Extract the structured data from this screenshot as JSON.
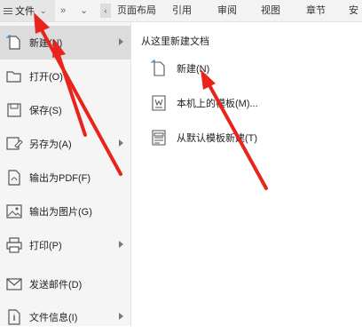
{
  "topbar": {
    "file_label": "文件",
    "tabs": [
      "页面布局",
      "引用",
      "审阅",
      "视图",
      "章节",
      "安全"
    ]
  },
  "sidebar": {
    "items": [
      {
        "label": "新建(N)",
        "icon": "new-doc-icon",
        "has_submenu": true,
        "active": true
      },
      {
        "label": "打开(O)",
        "icon": "folder-open-icon",
        "has_submenu": false
      },
      {
        "label": "保存(S)",
        "icon": "save-icon",
        "has_submenu": false
      },
      {
        "label": "另存为(A)",
        "icon": "save-as-icon",
        "has_submenu": true
      },
      {
        "label": "输出为PDF(F)",
        "icon": "pdf-export-icon",
        "has_submenu": false
      },
      {
        "label": "输出为图片(G)",
        "icon": "image-export-icon",
        "has_submenu": false
      },
      {
        "label": "打印(P)",
        "icon": "printer-icon",
        "has_submenu": true
      },
      {
        "label": "发送邮件(D)",
        "icon": "mail-icon",
        "has_submenu": false
      },
      {
        "label": "文件信息(I)",
        "icon": "file-info-icon",
        "has_submenu": true
      }
    ]
  },
  "panel": {
    "title": "从这里新建文档",
    "items": [
      {
        "label": "新建(N)",
        "icon": "blank-doc-icon"
      },
      {
        "label": "本机上的模板(M)...",
        "icon": "template-icon"
      },
      {
        "label": "从默认模板新建(T)",
        "icon": "default-template-icon"
      }
    ]
  },
  "colors": {
    "annotation_arrow": "#e8241c",
    "active_item_bg": "#dcdcdc"
  }
}
